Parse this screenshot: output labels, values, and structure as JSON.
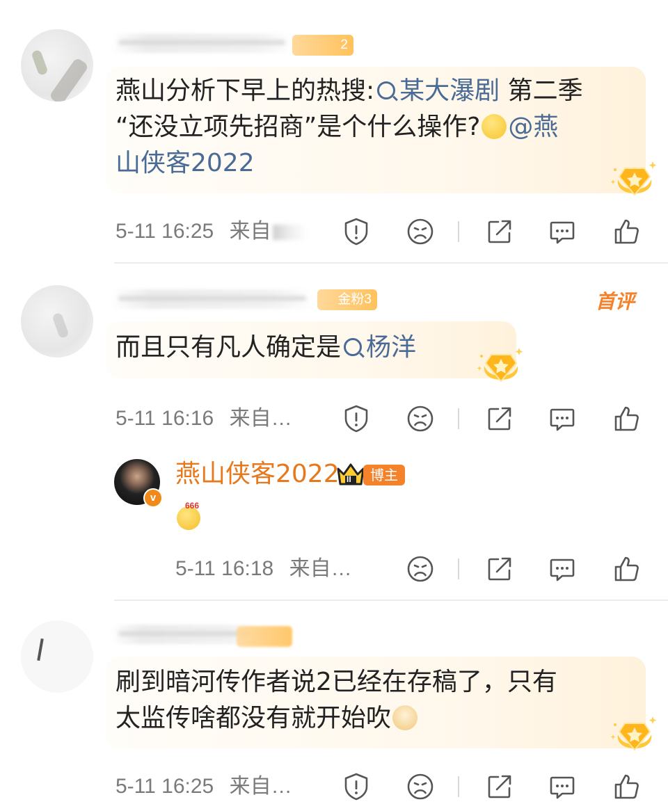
{
  "comments": [
    {
      "badge_label": "2",
      "text_plain": "燕山分析下早上的热搜:",
      "search_link": "某大瀑剧",
      "text_after_link": " 第二季",
      "line2": "“还没立项先招商”是个什么操作?",
      "mention_prefix": "@燕",
      "mention_line3": "山侠客2022",
      "time": "5-11 16:25",
      "source_prefix": "来自"
    },
    {
      "badge_label": "金粉3",
      "first_tag": "首评",
      "text_plain": "而且只有凡人确定是",
      "search_link": "杨洋",
      "time": "5-11 16:16",
      "source": "来自…"
    },
    {
      "text_line1": "刷到暗河传作者说2已经在存稿了，只有",
      "text_line2": "太监传啥都没有就开始吹",
      "time": "5-11 16:25",
      "source": "来自…"
    }
  ],
  "reply": {
    "name": "燕山侠客2022",
    "crown_level": "II",
    "tag": "博主",
    "emoji_text": "666",
    "time": "5-11 16:18",
    "source": "来自…"
  },
  "icons": {
    "report": "shield-exclamation-icon",
    "dislike": "sad-face-icon",
    "share": "share-arrow-icon",
    "comment": "comment-bubble-icon",
    "like": "thumbs-up-icon",
    "medal": "gold-star-medal-icon"
  },
  "colors": {
    "link": "#4a6b96",
    "reply_name": "#e8781c",
    "tag_bg": "#f4822a",
    "meta_text": "#7a7a7a"
  }
}
